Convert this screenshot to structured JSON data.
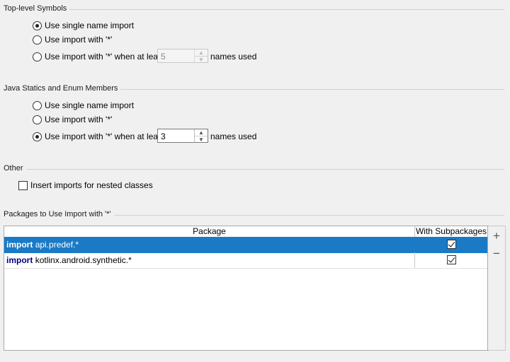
{
  "sections": {
    "top_level": "Top-level Symbols",
    "java_statics": "Java Statics and Enum Members",
    "other": "Other",
    "packages": "Packages to Use Import with '*'"
  },
  "top_level": {
    "opt_single": "Use single name import",
    "opt_star": "Use import with '*'",
    "opt_star_at_least": "Use import with '*' when at least",
    "count": "5",
    "names_used": "names used",
    "selected": "opt_single",
    "count_enabled": false
  },
  "java_statics": {
    "opt_single": "Use single name import",
    "opt_star": "Use import with '*'",
    "opt_star_at_least": "Use import with '*' when at least",
    "count": "3",
    "names_used": "names used",
    "selected": "opt_star_at_least",
    "count_enabled": true
  },
  "other": {
    "nested_classes": "Insert imports for nested classes",
    "nested_checked": false
  },
  "packages_table": {
    "col_package": "Package",
    "col_subpackages": "With Subpackages",
    "rows": [
      {
        "keyword": "import",
        "name": "api.predef.*",
        "with_subpackages": true,
        "selected": true
      },
      {
        "keyword": "import",
        "name": "kotlinx.android.synthetic.*",
        "with_subpackages": true,
        "selected": false
      }
    ]
  },
  "toolbar": {
    "add_icon": "plus-icon",
    "remove_icon": "minus-icon",
    "add_glyph": "+",
    "remove_glyph": "−"
  }
}
